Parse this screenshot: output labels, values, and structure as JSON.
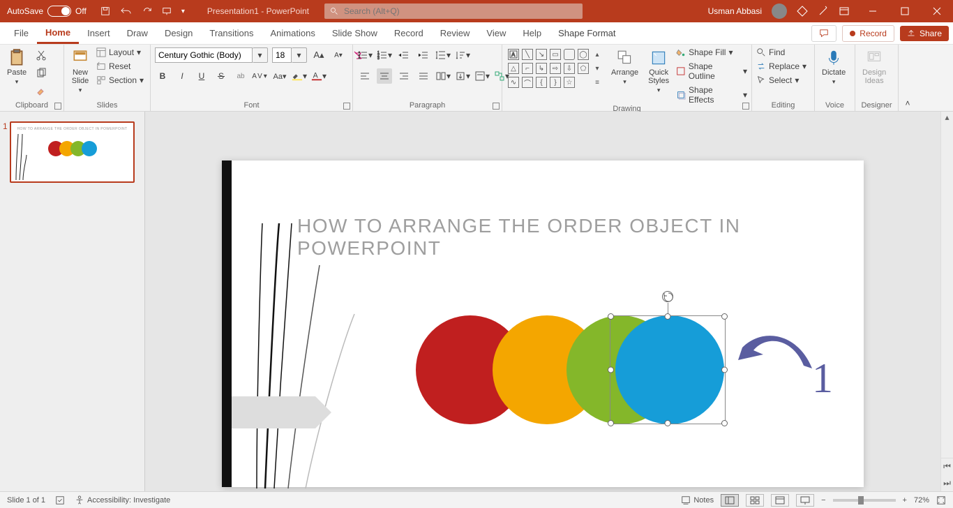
{
  "titlebar": {
    "autosave_label": "AutoSave",
    "autosave_state": "Off",
    "doc_title": "Presentation1 - PowerPoint",
    "search_placeholder": "Search (Alt+Q)",
    "user_name": "Usman Abbasi"
  },
  "tabs": {
    "items": [
      "File",
      "Home",
      "Insert",
      "Draw",
      "Design",
      "Transitions",
      "Animations",
      "Slide Show",
      "Record",
      "Review",
      "View",
      "Help",
      "Shape Format"
    ],
    "active": "Home",
    "comments_icon": "comments-icon",
    "record_label": "Record",
    "share_label": "Share"
  },
  "ribbon": {
    "clipboard": {
      "paste": "Paste",
      "label": "Clipboard"
    },
    "slides": {
      "new_slide": "New\nSlide",
      "layout": "Layout",
      "reset": "Reset",
      "section": "Section",
      "label": "Slides"
    },
    "font": {
      "name": "Century Gothic (Body)",
      "size": "18",
      "label": "Font"
    },
    "paragraph": {
      "label": "Paragraph"
    },
    "drawing": {
      "arrange": "Arrange",
      "quick": "Quick\nStyles",
      "fill": "Shape Fill",
      "outline": "Shape Outline",
      "effects": "Shape Effects",
      "label": "Drawing"
    },
    "editing": {
      "find": "Find",
      "replace": "Replace",
      "select": "Select",
      "label": "Editing"
    },
    "voice": {
      "dictate": "Dictate",
      "label": "Voice"
    },
    "designer": {
      "ideas": "Design\nIdeas",
      "label": "Designer"
    }
  },
  "thumb": {
    "number": "1",
    "title": "HOW TO ARRANGE THE ORDER  OBJECT  IN POWERPOINT"
  },
  "slide": {
    "title": "HOW TO ARRANGE THE ORDER  OBJECT  IN POWERPOINT",
    "annotation_number": "1",
    "colors": {
      "red": "#c01f1f",
      "yellow": "#f4a600",
      "green": "#84b72a",
      "blue": "#169dd8"
    }
  },
  "status": {
    "slide_info": "Slide 1 of 1",
    "accessibility": "Accessibility: Investigate",
    "notes": "Notes",
    "zoom": "72%"
  }
}
